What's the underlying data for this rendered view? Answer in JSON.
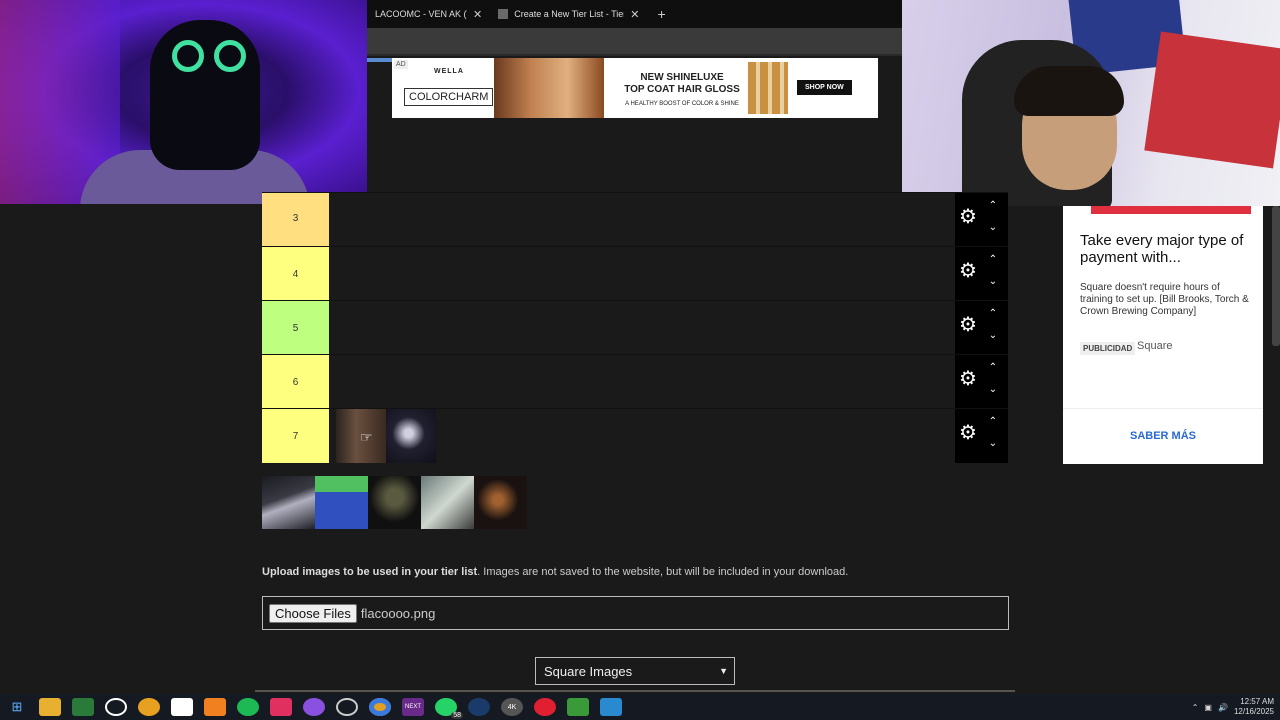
{
  "browser": {
    "tabs": [
      {
        "label": "LACOOMC - VEN AK (VIDEO",
        "close": "✕"
      },
      {
        "label": "Create a New Tier List - TierMaker",
        "close": "✕"
      }
    ],
    "new_tab": "+"
  },
  "top_ad": {
    "ad_tag": "AD",
    "brand_top": "WELLA",
    "brand": "COLORCHARM",
    "headline_1": "NEW SHINELUXE",
    "headline_2": "TOP COAT HAIR GLOSS",
    "headline_3": "A HEALTHY BOOST OF COLOR & SHINE",
    "cta": "SHOP NOW"
  },
  "tiers": [
    {
      "label": "3",
      "color": "#ffdf80"
    },
    {
      "label": "4",
      "color": "#ffff7f"
    },
    {
      "label": "5",
      "color": "#bfff7f"
    },
    {
      "label": "6",
      "color": "#ffff7f"
    },
    {
      "label": "7",
      "color": "#ffff7f"
    }
  ],
  "upload": {
    "bold": "Upload images to be used in your tier list",
    "rest": ". Images are not saved to the website, but will be included in your download.",
    "choose_label": "Choose Files",
    "file_name": "flacoooo.png"
  },
  "image_style_select": {
    "value": "Square Images"
  },
  "side_ad": {
    "headline": "Take every major type of payment with...",
    "body": "Square doesn't require hours of training to set up. [Bill Brooks, Torch & Crown Brewing Company]",
    "tag": "PUBLICIDAD",
    "advertiser": "Square",
    "cta": "SABER MÁS"
  },
  "taskbar": {
    "time": "12:57 AM",
    "date": "12/16/2025",
    "whatsapp_badge": "58"
  }
}
